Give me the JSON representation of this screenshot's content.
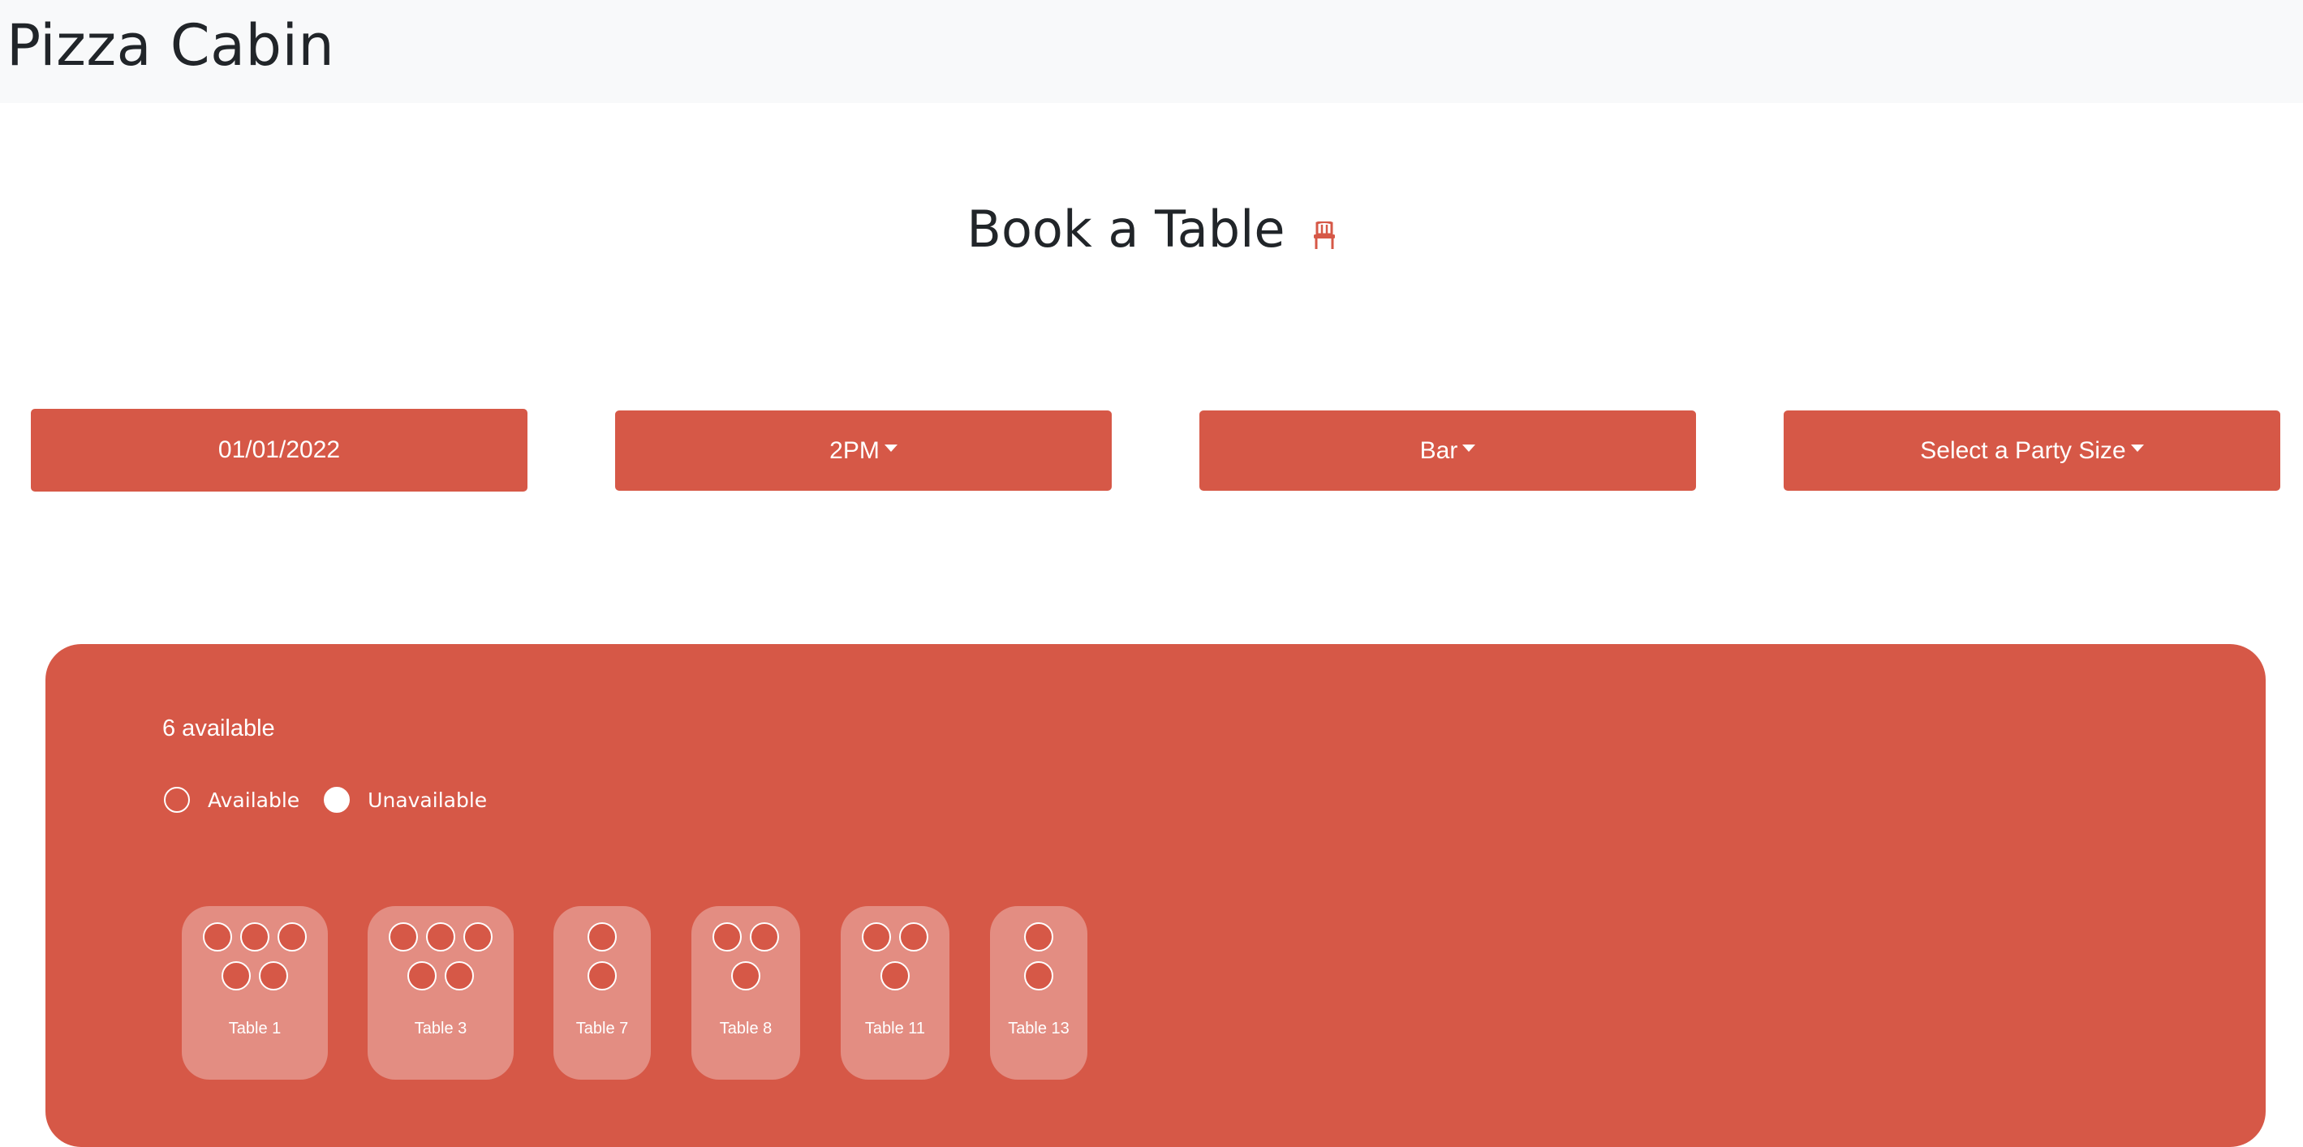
{
  "navbar": {
    "brand": "Pizza Cabin"
  },
  "page": {
    "heading": "Book a Table",
    "heading_icon": "chair-icon"
  },
  "controls": {
    "date_value": "01/01/2022",
    "time_label": "2PM",
    "area_label": "Bar",
    "party_size_label": "Select a Party Size"
  },
  "availability": {
    "count_text": "6 available",
    "legend_available": "Available",
    "legend_unavailable": "Unavailable"
  },
  "tables": [
    {
      "label": "Table 1",
      "seats": 5
    },
    {
      "label": "Table 3",
      "seats": 5
    },
    {
      "label": "Table 7",
      "seats": 2
    },
    {
      "label": "Table 8",
      "seats": 3
    },
    {
      "label": "Table 11",
      "seats": 3
    },
    {
      "label": "Table 13",
      "seats": 2
    }
  ],
  "colors": {
    "accent": "#d65847",
    "navbar_bg": "#f8f9fa",
    "text_dark": "#212529",
    "on_accent": "#ffffff"
  }
}
